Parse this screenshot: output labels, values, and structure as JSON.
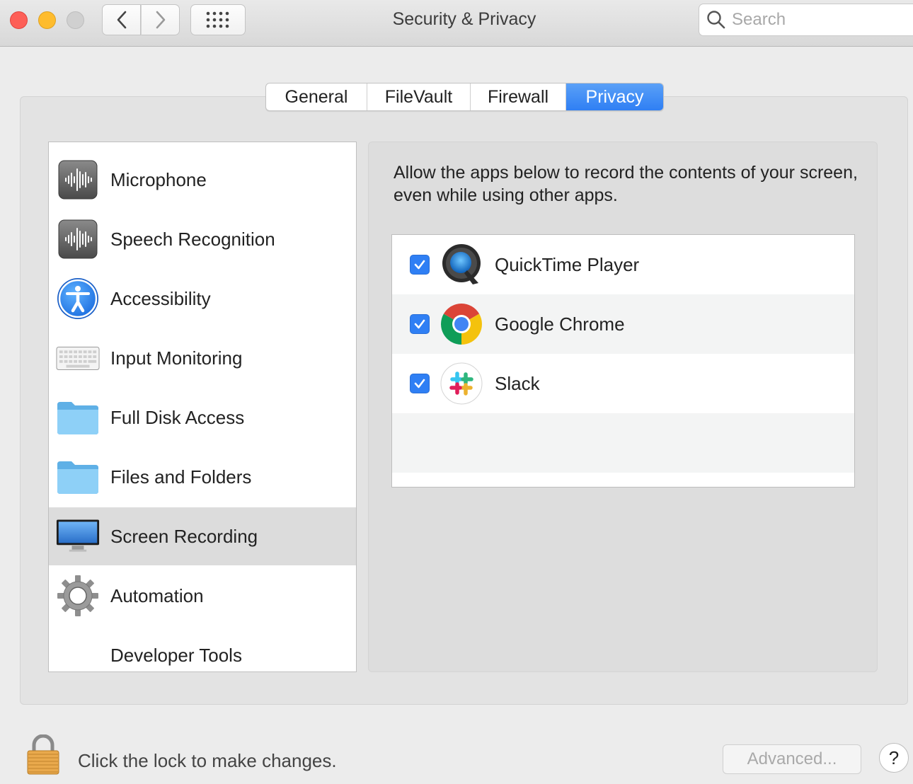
{
  "window": {
    "title": "Security & Privacy"
  },
  "toolbar": {
    "back_icon": "chevron-left-icon",
    "forward_icon": "chevron-right-icon",
    "show_all_icon": "grid-icon"
  },
  "search": {
    "placeholder": "Search",
    "value": ""
  },
  "tabs": [
    {
      "label": "General",
      "selected": false
    },
    {
      "label": "FileVault",
      "selected": false
    },
    {
      "label": "Firewall",
      "selected": false
    },
    {
      "label": "Privacy",
      "selected": true
    }
  ],
  "sidebar": {
    "items": [
      {
        "label": "Microphone",
        "icon": "microphone-waveform-icon",
        "selected": false
      },
      {
        "label": "Speech Recognition",
        "icon": "speech-waveform-icon",
        "selected": false
      },
      {
        "label": "Accessibility",
        "icon": "accessibility-icon",
        "selected": false
      },
      {
        "label": "Input Monitoring",
        "icon": "keyboard-icon",
        "selected": false
      },
      {
        "label": "Full Disk Access",
        "icon": "folder-icon",
        "selected": false
      },
      {
        "label": "Files and Folders",
        "icon": "folder-icon",
        "selected": false
      },
      {
        "label": "Screen Recording",
        "icon": "monitor-icon",
        "selected": true
      },
      {
        "label": "Automation",
        "icon": "gear-icon",
        "selected": false
      },
      {
        "label": "Developer Tools",
        "icon": "",
        "selected": false
      }
    ]
  },
  "main": {
    "description": "Allow the apps below to record the contents of your screen, even while using other apps.",
    "apps": [
      {
        "name": "QuickTime Player",
        "checked": true,
        "icon": "quicktime-icon"
      },
      {
        "name": "Google Chrome",
        "checked": true,
        "icon": "chrome-icon"
      },
      {
        "name": "Slack",
        "checked": true,
        "icon": "slack-icon"
      }
    ]
  },
  "footer": {
    "lock_text": "Click the lock to make changes.",
    "advanced_label": "Advanced...",
    "help_label": "?"
  },
  "colors": {
    "accent": "#2f7ff4",
    "close": "#fd5f57",
    "minimize": "#febc2e",
    "zoom": "#d0d0d0",
    "selected_row": "#dcdcdc"
  }
}
